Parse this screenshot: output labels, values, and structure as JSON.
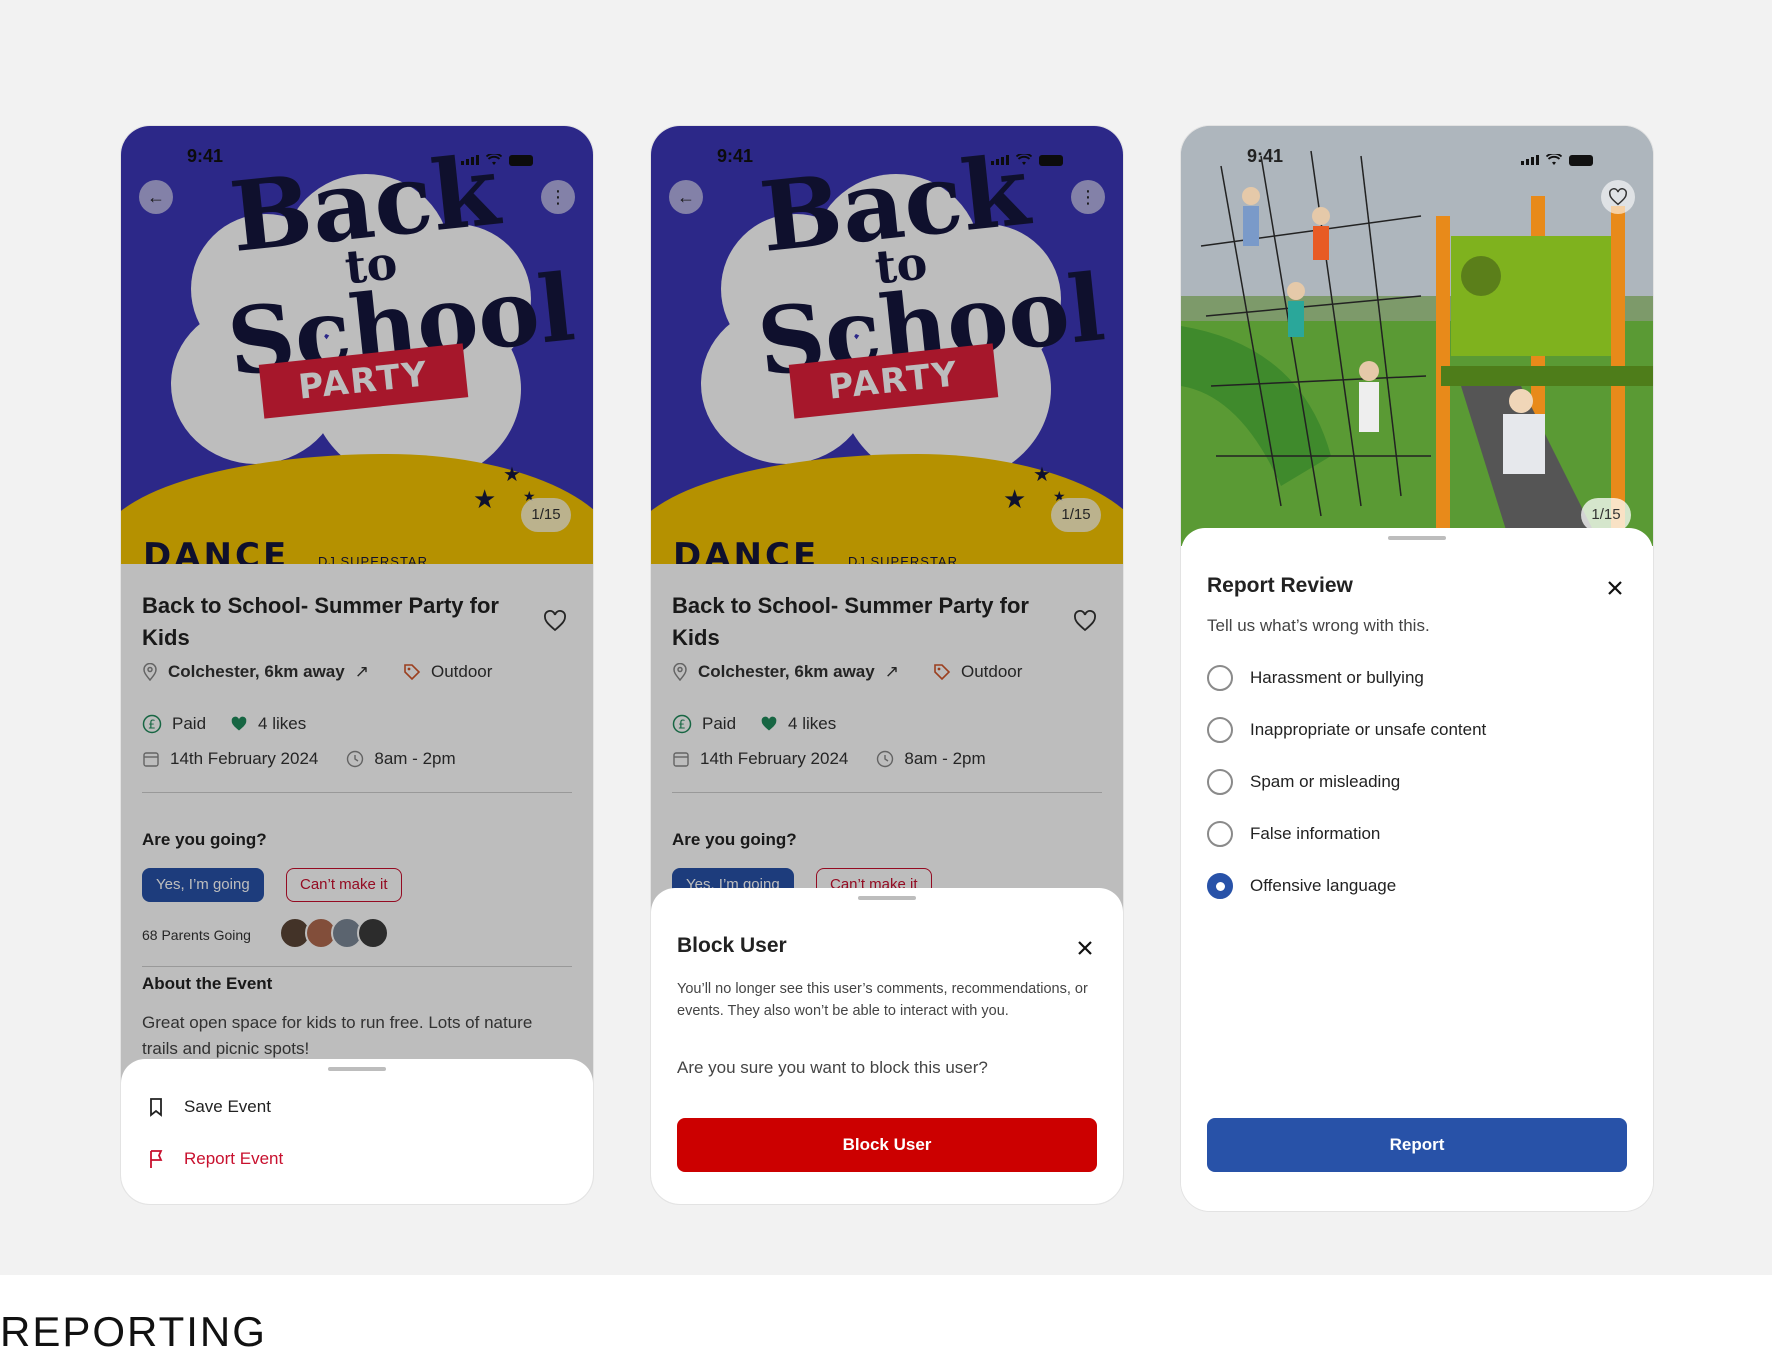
{
  "status": {
    "time": "9:41"
  },
  "poster": {
    "line1": "Back",
    "line2": "to",
    "line3": "School",
    "ribbon": "PARTY",
    "foot_left": "DANCE",
    "foot_right": "DJ SUPERSTAR",
    "counter": "1/15"
  },
  "event": {
    "title": "Back to School- Summer Party for Kids",
    "location": "Colchester, 6km away",
    "category": "Outdoor",
    "price": "Paid",
    "likes": "4 likes",
    "date": "14th February 2024",
    "time_range": "8am - 2pm",
    "question": "Are you going?",
    "yes_label": "Yes, I’m going",
    "no_label": "Can’t make it",
    "going_count": "68 Parents Going",
    "about_heading": "About the Event",
    "about_text": "Great open space for kids to run free. Lots of nature trails and picnic spots!"
  },
  "options_sheet": {
    "save_label": "Save Event",
    "report_label": "Report Event"
  },
  "block_sheet": {
    "title": "Block User",
    "description": "You’ll no longer see this user’s comments, recommendations, or events. They also won’t be able to interact with you.",
    "question": "Are you sure you want to block this user?",
    "button": "Block User"
  },
  "report_sheet": {
    "counter": "1/15",
    "title": "Report Review",
    "subtitle": "Tell us what’s wrong with this.",
    "options": [
      {
        "label": "Harassment or bullying",
        "selected": false
      },
      {
        "label": "Inappropriate or unsafe content",
        "selected": false
      },
      {
        "label": "Spam or misleading",
        "selected": false
      },
      {
        "label": "False information",
        "selected": false
      },
      {
        "label": "Offensive language",
        "selected": true
      }
    ],
    "button": "Report"
  },
  "section_label": "REPORTING",
  "colors": {
    "primary": "#2852a8",
    "danger": "#cc0000",
    "report_red": "#c8102e",
    "like_green": "#1f8a5b",
    "poster_blue": "#3c36b8",
    "poster_yellow": "#f5c400"
  }
}
